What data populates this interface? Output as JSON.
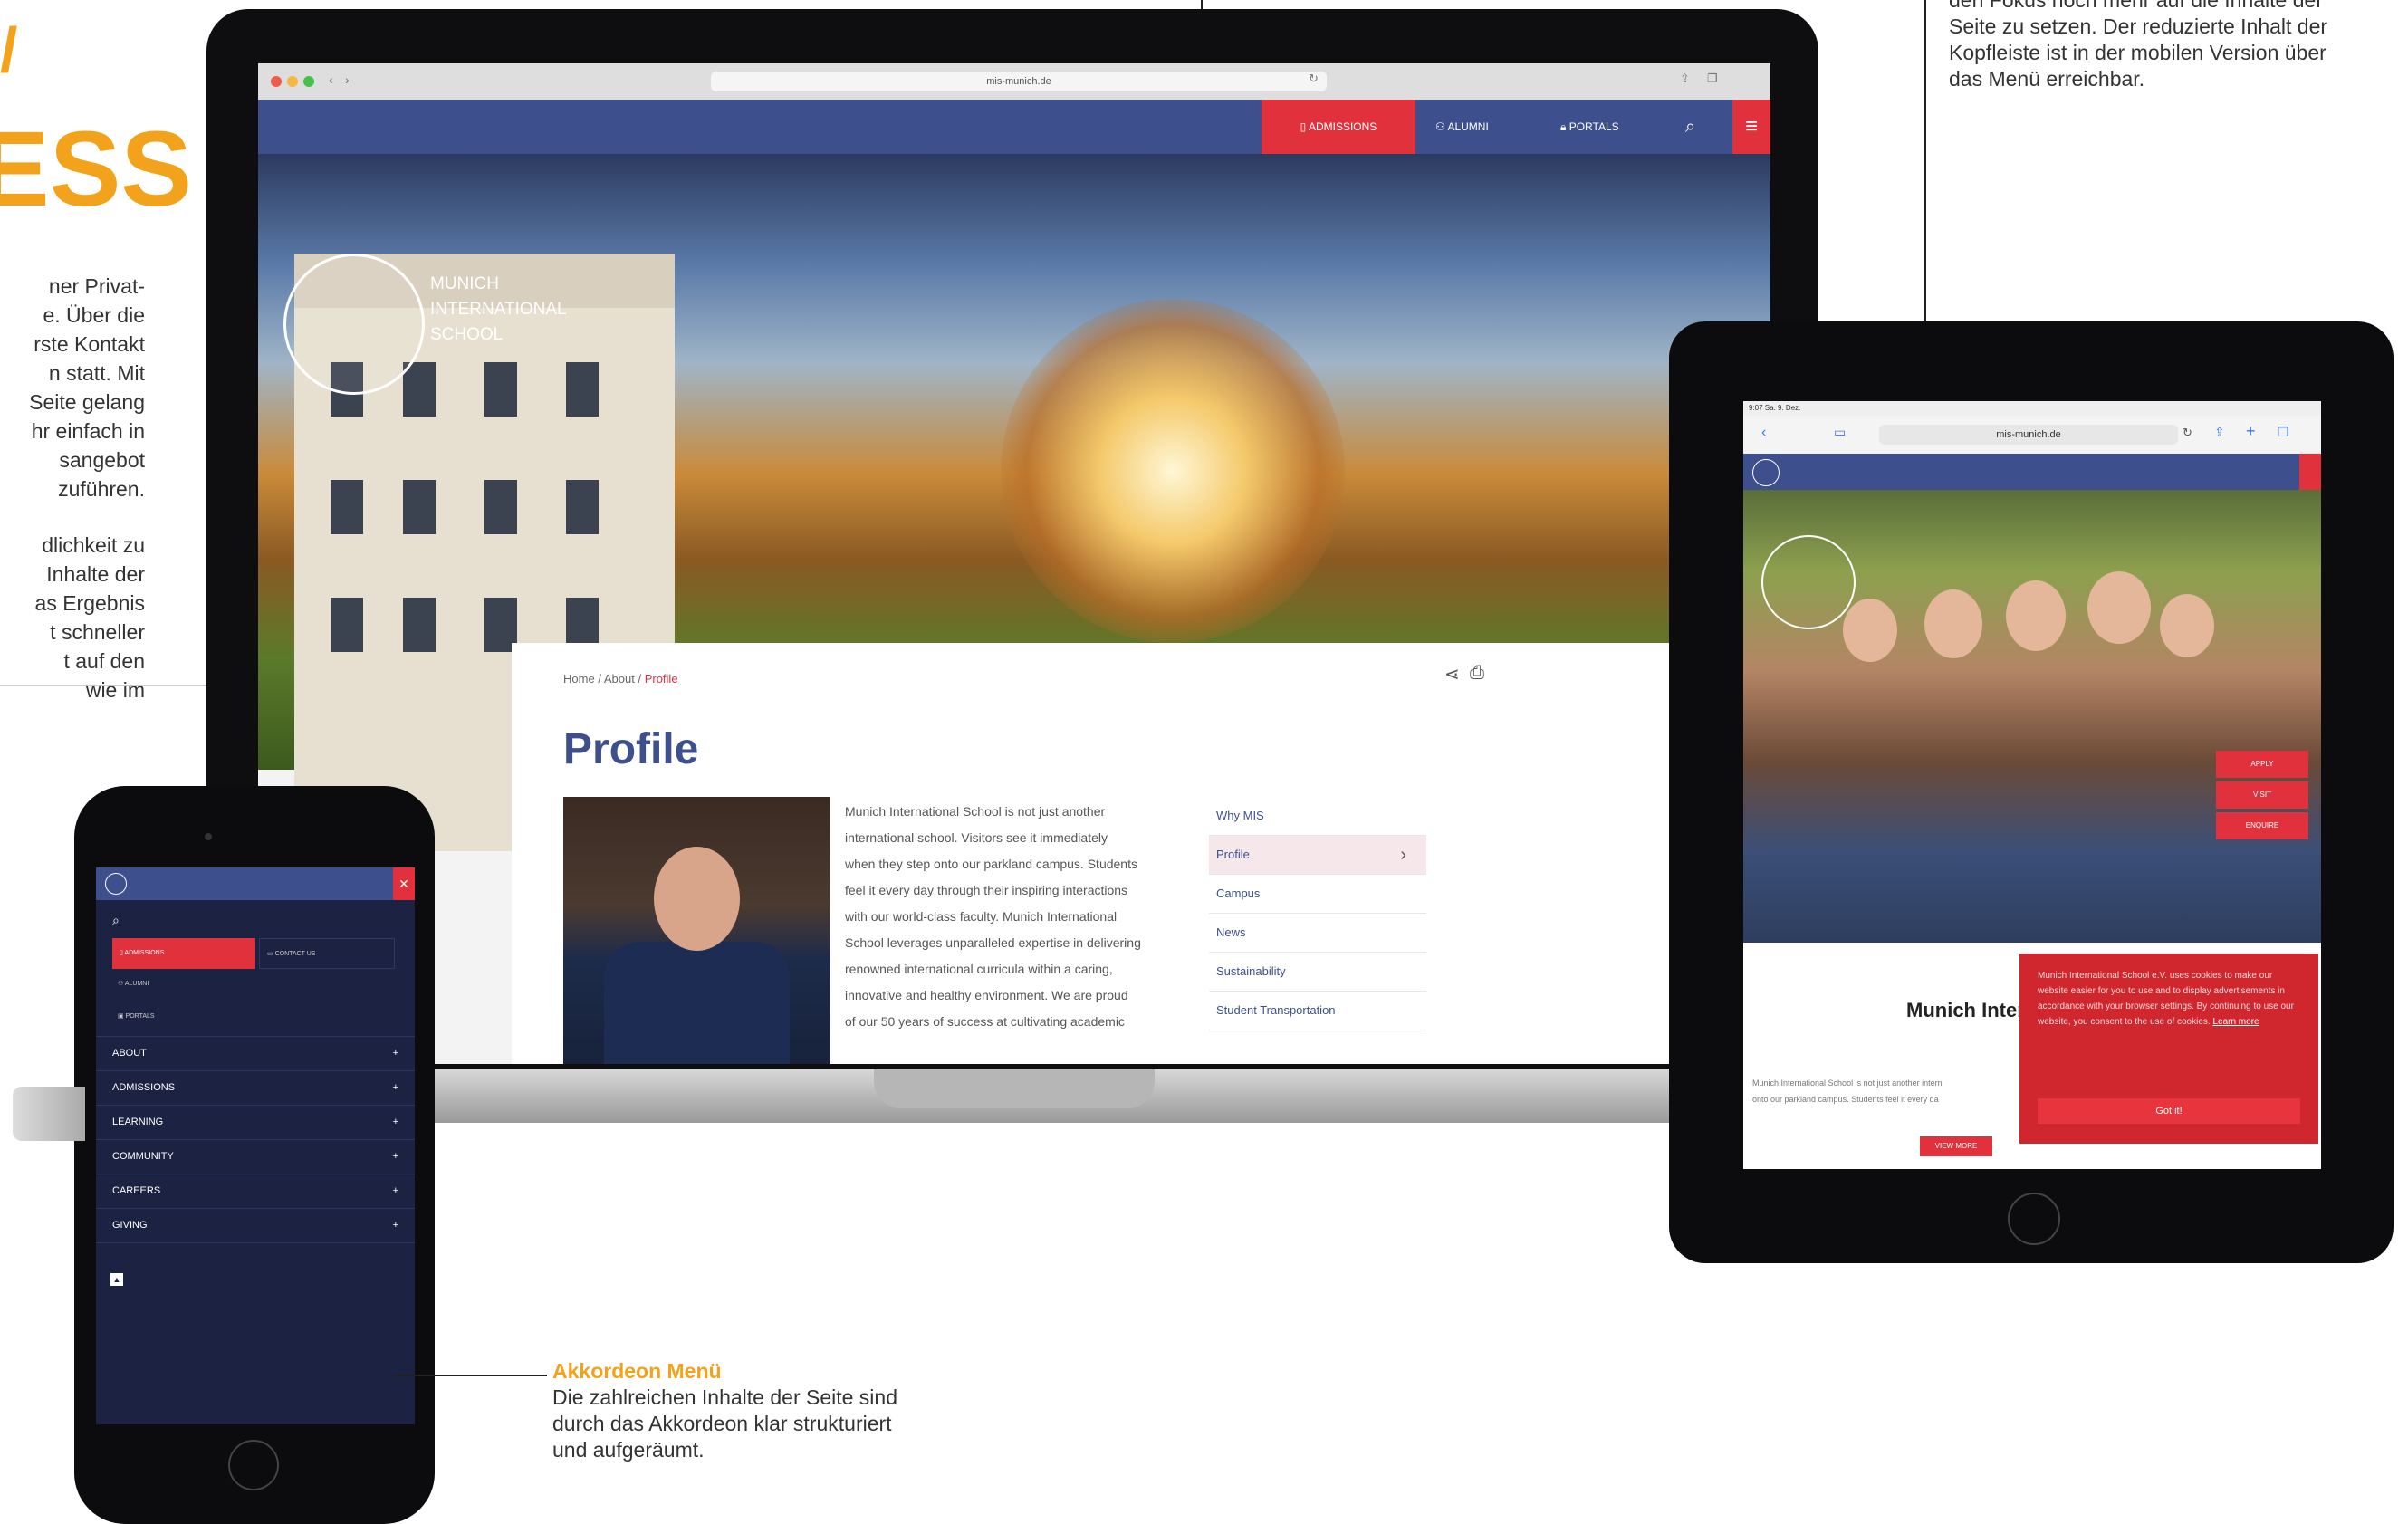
{
  "intro": {
    "hero_word_1": "/",
    "hero_word_2": "ESS",
    "paragraph_1": [
      "ner Privat-",
      "e. Über die",
      "rste Kontakt",
      "n statt. Mit",
      "Seite gelang",
      "hr einfach in",
      "sangebot",
      "zuführen."
    ],
    "paragraph_2": [
      "dlichkeit zu",
      "Inhalte der",
      "as Ergebnis",
      "t schneller",
      "t auf den",
      "wie im"
    ]
  },
  "right_note": {
    "lines": [
      "den Fokus noch mehr auf die Inhalte der",
      "Seite zu setzen. Der reduzierte Inhalt der",
      "Kopfleiste ist in der mobilen Version über",
      "das Menü erreichbar."
    ]
  },
  "accordion_note": {
    "title": "Akkordeon Menü",
    "text_lines": [
      "Die zahlreichen Inhalte der Seite sind",
      "durch das Akkordeon klar strukturiert",
      "und aufgeräumt."
    ]
  },
  "laptop": {
    "url": "mis-munich.de",
    "nav": {
      "admissions": "ADMISSIONS",
      "alumni": "ALUMNI",
      "portals": "PORTALS"
    },
    "logo_lines": [
      "MUNICH",
      "INTERNATIONAL",
      "SCHOOL"
    ],
    "breadcrumb": {
      "home": "Home",
      "about": "About",
      "current": "Profile",
      "sep": "/"
    },
    "title": "Profile",
    "body_lines": [
      "Munich International School is not just another",
      "international school. Visitors see it immediately",
      "when they step onto our parkland campus. Students",
      "feel it every day through their inspiring interactions",
      "with our world-class faculty. Munich International",
      "School leverages unparalleled expertise in delivering",
      "renowned international curricula within a caring,",
      "innovative and healthy environment. We are proud",
      "of our 50 years of success at cultivating academic"
    ],
    "side_menu": [
      "Why MIS",
      "Profile",
      "Campus",
      "News",
      "Sustainability",
      "Student Transportation"
    ]
  },
  "tablet": {
    "status": "9:07 Sa. 9. Dez.",
    "url": "mis-munich.de",
    "side_buttons": [
      "APPLY",
      "VISIT",
      "ENQUIRE"
    ],
    "welcome_partial": "Munich Inter",
    "body_partial": [
      "Munich International School is not just another intern",
      "onto our parkland campus. Students feel it every da"
    ],
    "cookie_text": "Munich International School e.V. uses cookies to make our website easier for you to use and to display advertisements in accordance with your browser settings. By continuing to use our website, you consent to the use of cookies.",
    "cookie_link": "Learn more",
    "cookie_button": "Got it!",
    "view_more": "VIEW MORE"
  },
  "phone": {
    "admissions": "ADMISSIONS",
    "contact": "CONTACT US",
    "alumni": "ALUMNI",
    "portals": "PORTALS",
    "close": "✕",
    "accordion": [
      "ABOUT",
      "ADMISSIONS",
      "LEARNING",
      "COMMUNITY",
      "CAREERS",
      "GIVING"
    ]
  },
  "colors": {
    "accent": "#f2a31b",
    "brand_blue": "#3e4f8e",
    "brand_red": "#e0313d",
    "navy": "#1c2342"
  }
}
